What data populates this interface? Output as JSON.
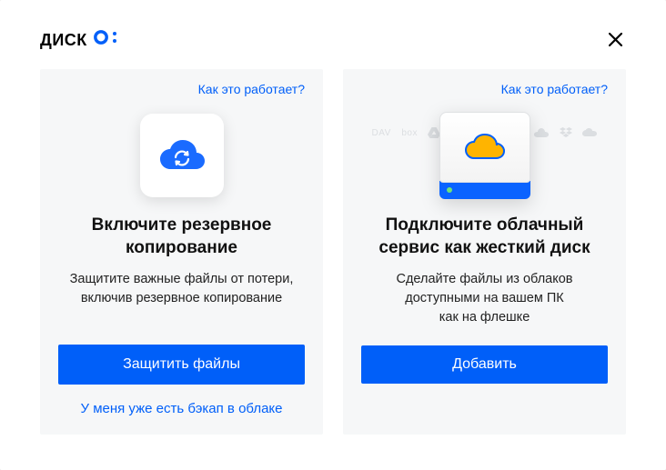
{
  "logo": {
    "text": "ДИСК"
  },
  "cards": {
    "backup": {
      "how_link": "Как это работает?",
      "title": "Включите резервное копирование",
      "desc": "Защитите важные файлы от потери, включив резервное копирование",
      "primary": "Защитить файлы",
      "secondary": "У меня уже есть бэкап в облаке"
    },
    "connect": {
      "how_link": "Как это работает?",
      "title": "Подключите облачный сервис как жесткий диск",
      "desc": "Сделайте файлы из облаков доступными на вашем ПК как на флешке",
      "primary": "Добавить"
    }
  },
  "colors": {
    "accent": "#005ff9"
  }
}
